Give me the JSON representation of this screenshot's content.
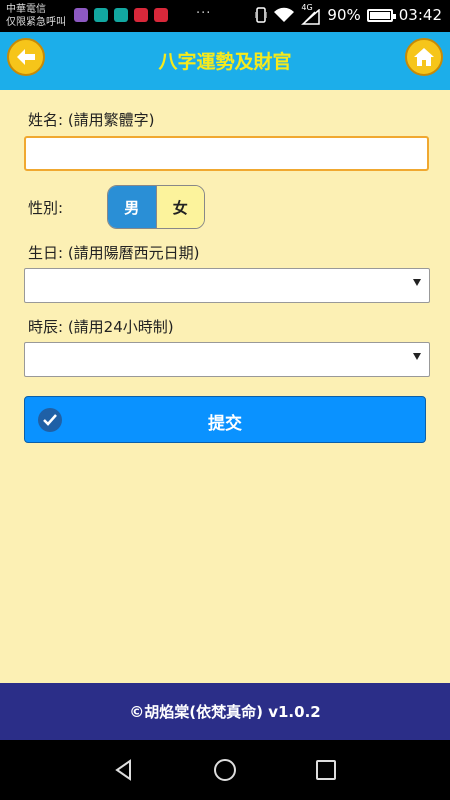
{
  "status_bar": {
    "carrier_line1": "中華電信",
    "carrier_line2": "仅限紧急呼叫",
    "network": "4G",
    "battery": "90%",
    "battery_level": 0.9,
    "time": "03:42",
    "overflow": "···"
  },
  "header": {
    "title": "八字運勢及財官",
    "back_icon": "arrow-left-icon",
    "home_icon": "home-icon"
  },
  "form": {
    "name_label": "姓名: (請用繁體字)",
    "name_value": "",
    "gender_label": "性別:",
    "gender_options": [
      "男",
      "女"
    ],
    "gender_selected": "男",
    "birth_label": "生日: (請用陽曆西元日期)",
    "birth_value": "",
    "hour_label": "時辰: (請用24小時制)",
    "hour_value": "",
    "submit_label": "提交"
  },
  "footer": {
    "text": "©胡焰棠(依梵真命) v1.0.2"
  },
  "colors": {
    "background": "#fcf0b4",
    "titlebar": "#1caeea",
    "title_text": "#f6ea1c",
    "button_accent": "#f6c51a",
    "submit": "#0a92ff",
    "gender_selected": "#2a8fd6",
    "footer": "#2b2e88"
  }
}
